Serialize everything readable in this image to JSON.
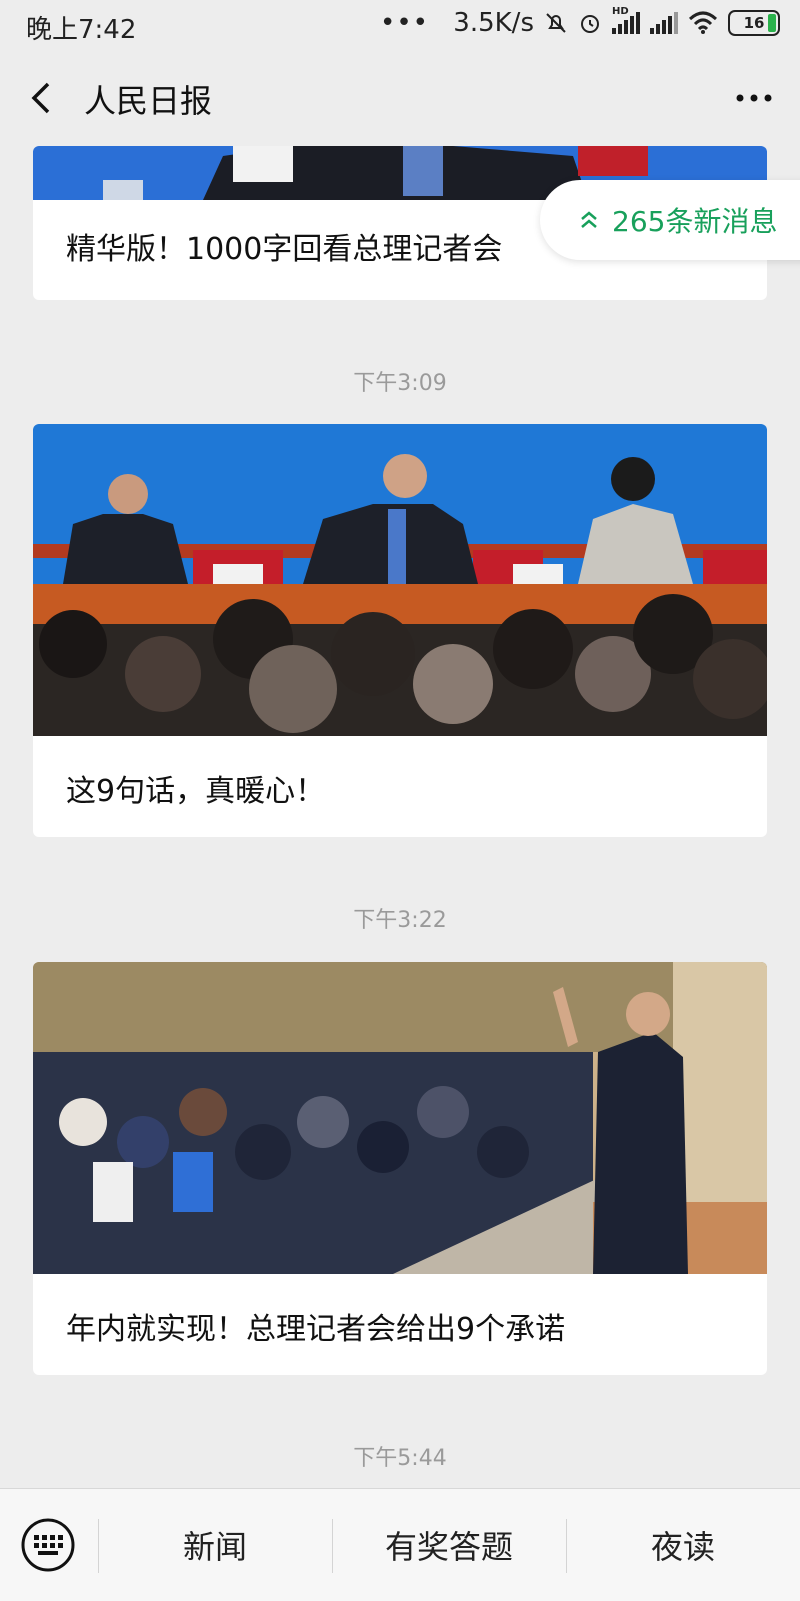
{
  "status_bar": {
    "time": "晚上7:42",
    "dots": "•••",
    "speed": "3.5K/s",
    "network_badge": "HD",
    "battery": "16"
  },
  "header": {
    "title": "人民日报"
  },
  "new_messages": {
    "label": "265条新消息"
  },
  "feed": [
    {
      "caption": "精华版！1000字回看总理记者会"
    },
    {
      "time": "下午3:09",
      "caption": "这9句话，真暖心！"
    },
    {
      "time": "下午3:22",
      "caption": "年内就实现！总理记者会给出9个承诺"
    },
    {
      "time": "下午5:44"
    }
  ],
  "bottom_menu": {
    "items": [
      "新闻",
      "有奖答题",
      "夜读"
    ]
  },
  "colors": {
    "accent": "#18a05b",
    "background": "#ededed"
  }
}
